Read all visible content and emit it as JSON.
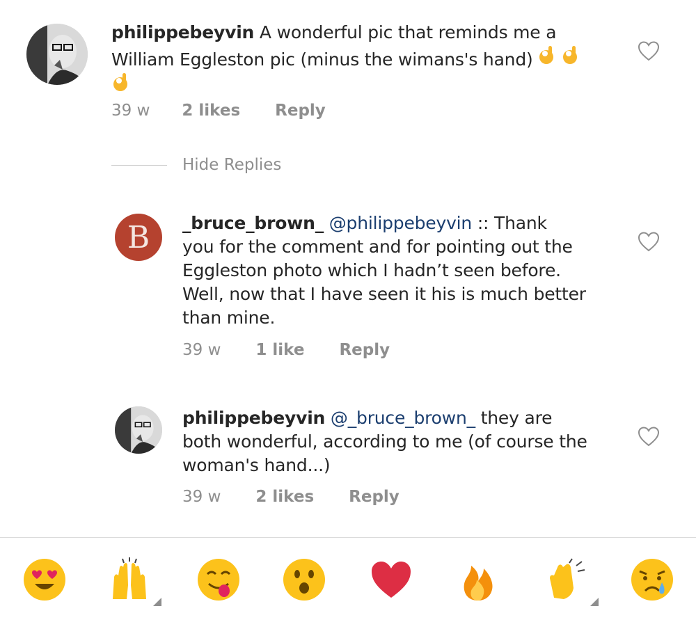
{
  "comments": [
    {
      "username": "philippebeyvin",
      "text": "A wonderful pic that reminds me a",
      "text_line2": "William Eggleston pic (minus the wimans's hand)",
      "time": "39 w",
      "likes": "2 likes",
      "reply_label": "Reply",
      "trailing_emoji": [
        "ok-hand-icon",
        "ok-hand-icon",
        "ok-hand-icon"
      ]
    },
    {
      "avatar_letter": "B",
      "username": "_bruce_brown_",
      "mention": "@philippebeyvin",
      "text_line1": ":: Thank",
      "text_line2": "you for the comment and for pointing out the",
      "text_line3": "Eggleston photo which I hadn’t seen before.",
      "text_line4": "Well, now that I have seen it his is much better",
      "text_line5": "than mine.",
      "time": "39 w",
      "likes": "1 like",
      "reply_label": "Reply"
    },
    {
      "username": "philippebeyvin",
      "mention": "@_bruce_brown_",
      "text_line1": "they are",
      "text_line2": "both wonderful, according to me (of course the",
      "text_line3": "woman's hand...)",
      "time": "39 w",
      "likes": "2 likes",
      "reply_label": "Reply"
    }
  ],
  "hide_replies_label": "Hide Replies",
  "emoji_bar": [
    "heart-eyes-icon",
    "raised-hands-icon",
    "yum-face-icon",
    "surprised-face-icon",
    "red-heart-icon",
    "fire-icon",
    "clapping-hands-icon",
    "crying-face-icon"
  ],
  "colors": {
    "mention": "#1b3e6f",
    "meta": "#8e8e8e",
    "avatar_b": "#b5422f"
  }
}
